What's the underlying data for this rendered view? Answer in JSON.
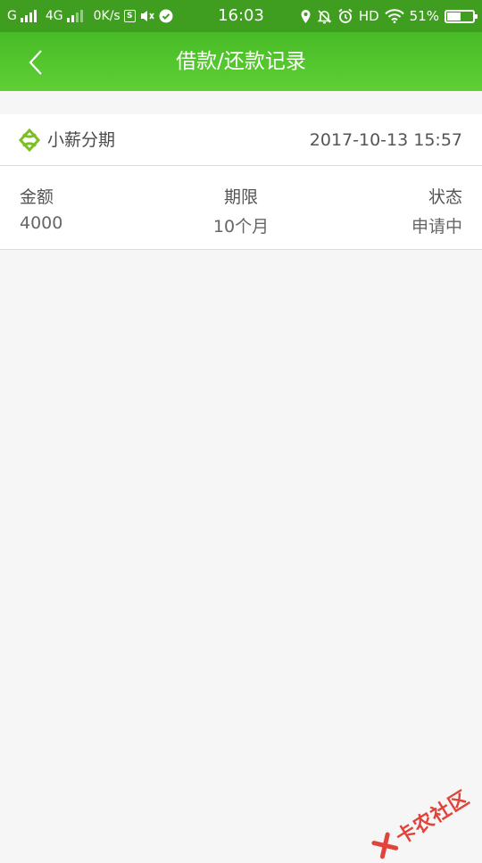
{
  "status_bar": {
    "sim1": "G",
    "network": "4G",
    "speed": "0K/s",
    "time": "16:03",
    "hd": "HD",
    "battery": "51%",
    "battery_level": 0.51
  },
  "header": {
    "title": "借款/还款记录",
    "color": "#4fc22c"
  },
  "record": {
    "product_name": "小薪分期",
    "datetime": "2017-10-13 15:57",
    "columns": [
      {
        "label": "金额",
        "value": "4000"
      },
      {
        "label": "期限",
        "value": "10个月"
      },
      {
        "label": "状态",
        "value": "申请中"
      }
    ]
  },
  "watermark": {
    "text": "卡农社区"
  }
}
